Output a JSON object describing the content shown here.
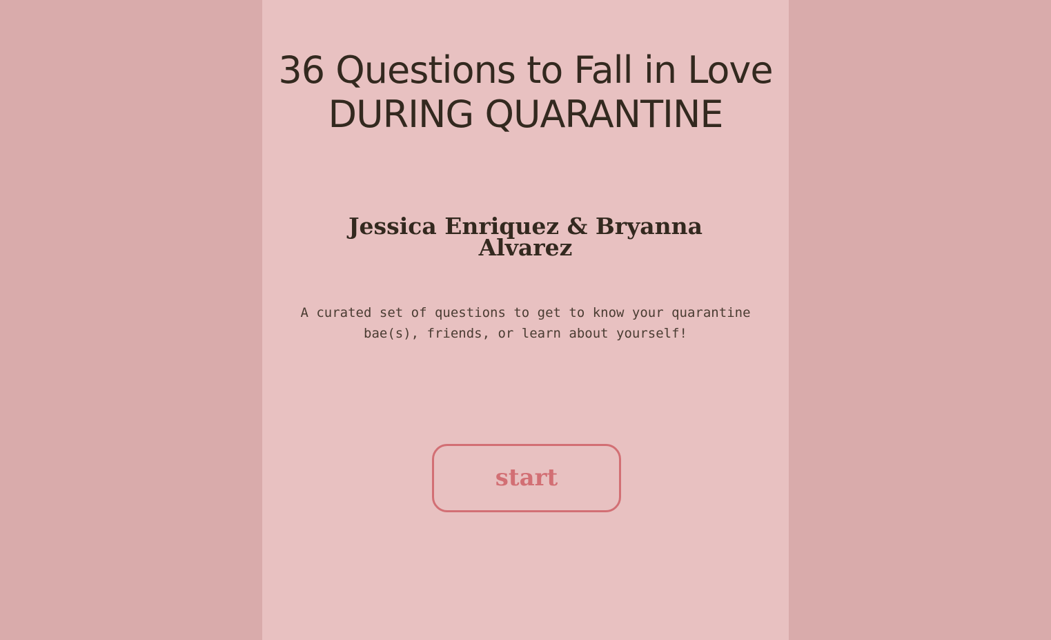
{
  "page": {
    "title_line1": "36 Questions to Fall in Love",
    "title_line2": "DURING QUARANTINE",
    "authors": "Jessica Enriquez & Bryanna Alvarez",
    "description": "A curated set of questions to get to know your quarantine bae(s), friends, or learn about yourself!",
    "start_label": "start"
  },
  "colors": {
    "outer_background": "#d9abab",
    "panel_background": "#e8c1c1",
    "text": "#33291f",
    "accent": "#d26f74"
  }
}
